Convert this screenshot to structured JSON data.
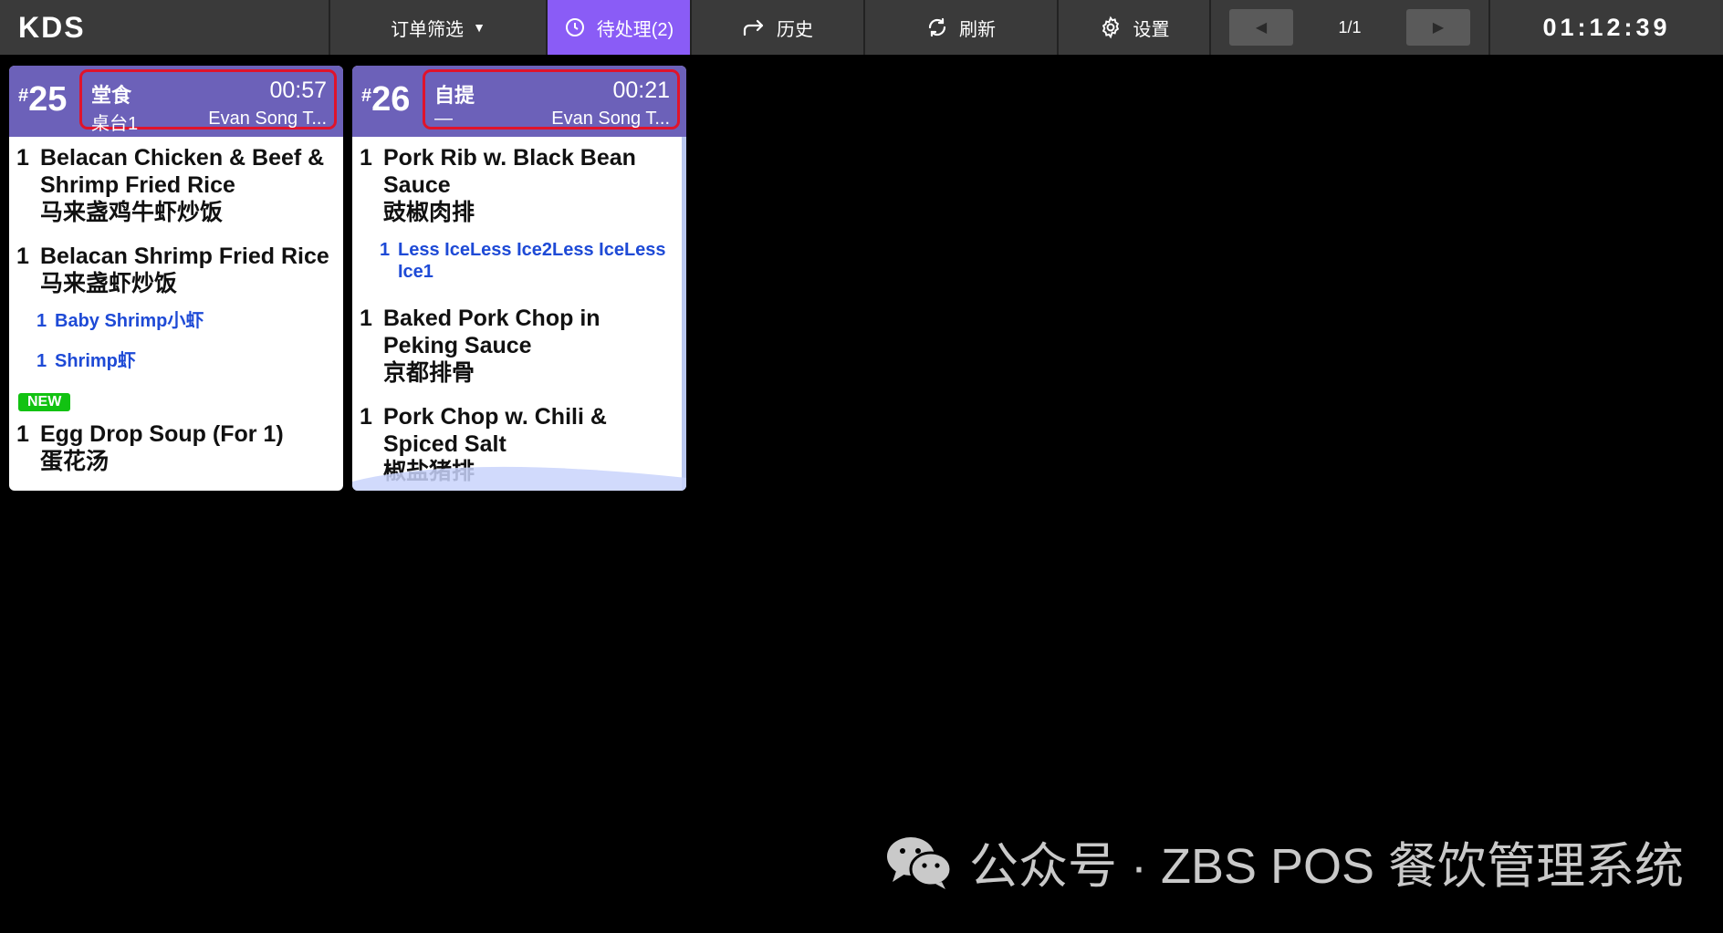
{
  "topbar": {
    "app_name": "KDS",
    "filter_label": "订单筛选",
    "pending_label": "待处理(2)",
    "history_label": "历史",
    "refresh_label": "刷新",
    "settings_label": "设置",
    "page_indicator": "1/1",
    "clock": "01:12:39"
  },
  "orders": [
    {
      "number": "25",
      "type": "堂食",
      "elapsed": "00:57",
      "table": "桌台1",
      "staff": "Evan Song T...",
      "items": [
        {
          "qty": "1",
          "name": "Belacan Chicken & Beef & Shrimp Fried Rice",
          "name_zh": "马来盏鸡牛虾炒饭"
        },
        {
          "qty": "1",
          "name": "Belacan Shrimp Fried Rice",
          "name_zh": "马来盏虾炒饭"
        },
        {
          "qty": "1",
          "name": "Egg Drop Soup (For 1)",
          "name_zh": "蛋花汤"
        }
      ],
      "modifiers": [
        {
          "qty": "1",
          "label": "Baby Shrimp小虾"
        },
        {
          "qty": "1",
          "label": "Shrimp虾"
        }
      ],
      "new_badge": "NEW"
    },
    {
      "number": "26",
      "type": "自提",
      "elapsed": "00:21",
      "table": "—",
      "staff": "Evan Song T...",
      "items": [
        {
          "qty": "1",
          "name": "Pork Rib w. Black Bean Sauce",
          "name_zh": "豉椒肉排"
        },
        {
          "qty": "1",
          "name": "Baked Pork Chop in Peking Sauce",
          "name_zh": "京都排骨"
        },
        {
          "qty": "1",
          "name": "Pork Chop w. Chili & Spiced Salt",
          "name_zh": "椒盐猪排"
        }
      ],
      "modifiers": [
        {
          "qty": "1",
          "label": "Less IceLess Ice2Less IceLess Ice1"
        }
      ]
    }
  ],
  "watermark": {
    "text": "公众号 · ZBS POS 餐饮管理系统",
    "icon": "wechat-icon"
  },
  "colors": {
    "topbar": "#3a3a3a",
    "pending_active": "#8a5cf6",
    "card_header": "#6c61b9",
    "header_outline": "#e0132b",
    "modifier_text": "#1e4ad6",
    "new_badge": "#12c212"
  }
}
